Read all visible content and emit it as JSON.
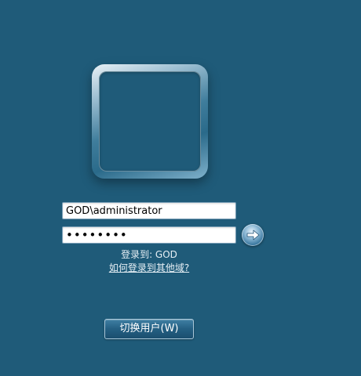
{
  "login": {
    "username_value": "GOD\\administrator",
    "password_value": "••••••••",
    "domain_label": "登录到: GOD",
    "other_domain_link": "如何登录到其他域?",
    "switch_user_label": "切换用户(W)"
  },
  "icons": {
    "submit": "arrow-right-icon"
  },
  "colors": {
    "background": "#1f5b79",
    "text": "#e6eff5"
  }
}
